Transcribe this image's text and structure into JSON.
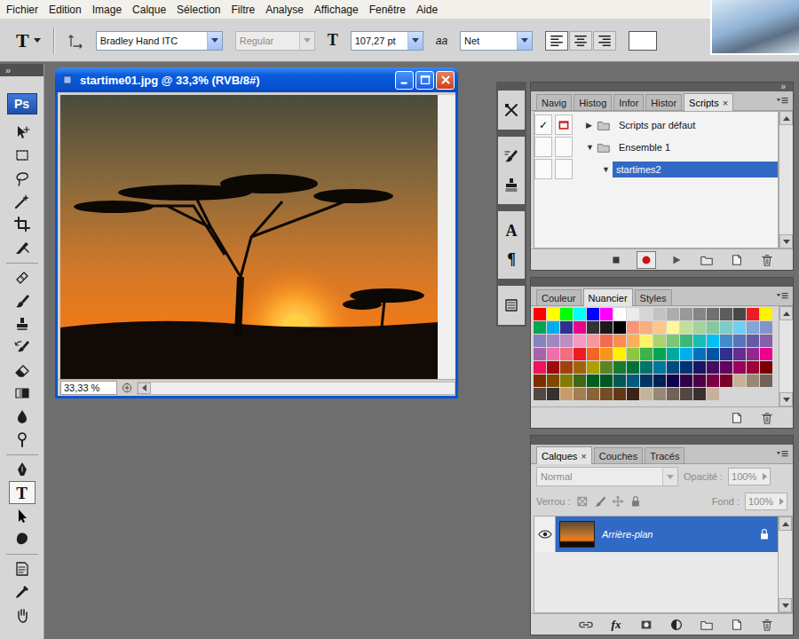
{
  "menu_bar": {
    "items": [
      "Fichier",
      "Edition",
      "Image",
      "Calque",
      "Sélection",
      "Filtre",
      "Analyse",
      "Affichage",
      "Fenêtre",
      "Aide"
    ]
  },
  "options_bar": {
    "tool_glyph": "T",
    "font_family": {
      "value": "Bradley Hand ITC",
      "disabled": false
    },
    "font_style": {
      "value": "Regular",
      "disabled": true
    },
    "size_glyph": "T",
    "font_size": {
      "value": "107,27 pt",
      "disabled": false
    },
    "antialias_glyph": "aa",
    "antialias": {
      "value": "Net",
      "disabled": false
    },
    "align": [
      {
        "kind": "align-left",
        "selected": true
      },
      {
        "kind": "align-center",
        "selected": false
      },
      {
        "kind": "align-right",
        "selected": false
      }
    ]
  },
  "toolbox": {
    "collapse": "»",
    "logo": "Ps",
    "tools": [
      {
        "kind": "move",
        "selected": false
      },
      {
        "kind": "marquee",
        "selected": false
      },
      {
        "kind": "lasso",
        "selected": false
      },
      {
        "kind": "wand",
        "selected": false
      },
      {
        "kind": "crop",
        "selected": false
      },
      {
        "kind": "slice",
        "selected": false
      },
      {
        "kind": "separator",
        "selected": false
      },
      {
        "kind": "healing",
        "selected": false
      },
      {
        "kind": "brush",
        "selected": false
      },
      {
        "kind": "stamp",
        "selected": false
      },
      {
        "kind": "history-brush",
        "selected": false
      },
      {
        "kind": "eraser",
        "selected": false
      },
      {
        "kind": "gradient",
        "selected": false
      },
      {
        "kind": "blur",
        "selected": false
      },
      {
        "kind": "dodge",
        "selected": false
      },
      {
        "kind": "separator",
        "selected": false
      },
      {
        "kind": "pen",
        "selected": false
      },
      {
        "kind": "glyph",
        "glyph": "T",
        "selected": true
      },
      {
        "kind": "path-select",
        "selected": false
      },
      {
        "kind": "shape",
        "selected": false
      },
      {
        "kind": "separator",
        "selected": false
      },
      {
        "kind": "notes",
        "selected": false
      },
      {
        "kind": "eyedropper",
        "selected": false
      },
      {
        "kind": "hand",
        "selected": false
      }
    ]
  },
  "document": {
    "title": "startime01.jpg @ 33,3% (RVB/8#)",
    "zoom": "33,33 %"
  },
  "icon_strip": [
    {
      "items": [
        {
          "kind": "tool-presets"
        }
      ]
    },
    {
      "items": [
        {
          "kind": "brushes"
        },
        {
          "kind": "clone-source"
        }
      ]
    },
    {
      "items": [
        {
          "kind": "glyph",
          "glyph": "A"
        },
        {
          "kind": "glyph",
          "glyph": "¶"
        }
      ]
    },
    {
      "items": [
        {
          "kind": "layer-comps"
        }
      ]
    }
  ],
  "dock_collapse": "»",
  "scripts_panel": {
    "tabs": [
      {
        "label": "Navig",
        "selected": false
      },
      {
        "label": "Histog",
        "selected": false
      },
      {
        "label": "Infor",
        "selected": false
      },
      {
        "label": "Histor",
        "selected": false
      },
      {
        "label": "Scripts",
        "selected": true,
        "close": "×"
      }
    ],
    "check_mark": "✓",
    "rows": [
      {
        "checked": true,
        "dialog": true,
        "depth": 0,
        "toggle": "▶",
        "folder": true,
        "label": "Scripts par défaut",
        "selected": false
      },
      {
        "checked": false,
        "dialog": false,
        "depth": 0,
        "toggle": "▼",
        "folder": true,
        "label": "Ensemble 1",
        "selected": false
      },
      {
        "checked": false,
        "dialog": false,
        "depth": 1,
        "toggle": "▼",
        "folder": false,
        "label": "startimes2",
        "selected": true
      }
    ],
    "buttons": [
      {
        "kind": "stop",
        "selected": false
      },
      {
        "kind": "record",
        "selected": true
      },
      {
        "kind": "play",
        "selected": false
      },
      {
        "kind": "new-set",
        "selected": false
      },
      {
        "kind": "new-action",
        "selected": false
      },
      {
        "kind": "delete",
        "selected": false
      }
    ]
  },
  "swatches_panel": {
    "tabs": [
      {
        "label": "Couleur",
        "selected": false
      },
      {
        "label": "Nuancier",
        "selected": true
      },
      {
        "label": "Styles",
        "selected": false
      }
    ],
    "swatches": [
      {
        "color": "#ff0000"
      },
      {
        "color": "#ffff00"
      },
      {
        "color": "#00ff00"
      },
      {
        "color": "#00ffff"
      },
      {
        "color": "#0000ff"
      },
      {
        "color": "#ff00ff"
      },
      {
        "color": "#ffffff"
      },
      {
        "color": "#ebebeb"
      },
      {
        "color": "#d6d6d6"
      },
      {
        "color": "#c2c2c2"
      },
      {
        "color": "#adadad"
      },
      {
        "color": "#999999"
      },
      {
        "color": "#858585"
      },
      {
        "color": "#707070"
      },
      {
        "color": "#5c5c5c"
      },
      {
        "color": "#474747"
      },
      {
        "color": "#ed1c24"
      },
      {
        "color": "#fff200"
      },
      {
        "color": "#00a651"
      },
      {
        "color": "#00aeef"
      },
      {
        "color": "#2e3192"
      },
      {
        "color": "#ec008c"
      },
      {
        "color": "#333333"
      },
      {
        "color": "#1a1a1a"
      },
      {
        "color": "#000000"
      },
      {
        "color": "#f7977a"
      },
      {
        "color": "#f9ad81"
      },
      {
        "color": "#fdc68a"
      },
      {
        "color": "#fff79a"
      },
      {
        "color": "#c4df9b"
      },
      {
        "color": "#a3d39c"
      },
      {
        "color": "#82ca9d"
      },
      {
        "color": "#7bcdc8"
      },
      {
        "color": "#6ecff6"
      },
      {
        "color": "#7ea7d8"
      },
      {
        "color": "#8493ca"
      },
      {
        "color": "#8882be"
      },
      {
        "color": "#a187be"
      },
      {
        "color": "#bc8dbf"
      },
      {
        "color": "#f49ac2"
      },
      {
        "color": "#f6989d"
      },
      {
        "color": "#f26c4f"
      },
      {
        "color": "#f68e55"
      },
      {
        "color": "#fbaf5c"
      },
      {
        "color": "#fff467"
      },
      {
        "color": "#acd372"
      },
      {
        "color": "#7cc576"
      },
      {
        "color": "#3bb878"
      },
      {
        "color": "#1abbb4"
      },
      {
        "color": "#00bff3"
      },
      {
        "color": "#438ccb"
      },
      {
        "color": "#5574b9"
      },
      {
        "color": "#605ca8"
      },
      {
        "color": "#855fa8"
      },
      {
        "color": "#a763a8"
      },
      {
        "color": "#f06ea9"
      },
      {
        "color": "#f26d7d"
      },
      {
        "color": "#ed1c24"
      },
      {
        "color": "#f26522"
      },
      {
        "color": "#f7941d"
      },
      {
        "color": "#fff200"
      },
      {
        "color": "#8dc73f"
      },
      {
        "color": "#39b54a"
      },
      {
        "color": "#00a651"
      },
      {
        "color": "#00a99d"
      },
      {
        "color": "#00aeef"
      },
      {
        "color": "#0072bc"
      },
      {
        "color": "#0054a6"
      },
      {
        "color": "#2e3192"
      },
      {
        "color": "#662d91"
      },
      {
        "color": "#92278f"
      },
      {
        "color": "#ec008c"
      },
      {
        "color": "#ed145b"
      },
      {
        "color": "#9e0b0f"
      },
      {
        "color": "#a0410d"
      },
      {
        "color": "#a36209"
      },
      {
        "color": "#aba000"
      },
      {
        "color": "#598527"
      },
      {
        "color": "#197b30"
      },
      {
        "color": "#007236"
      },
      {
        "color": "#00746b"
      },
      {
        "color": "#0076a3"
      },
      {
        "color": "#004b80"
      },
      {
        "color": "#003471"
      },
      {
        "color": "#1b1464"
      },
      {
        "color": "#440e62"
      },
      {
        "color": "#630460"
      },
      {
        "color": "#9e005d"
      },
      {
        "color": "#9e0039"
      },
      {
        "color": "#790000"
      },
      {
        "color": "#7b2e00"
      },
      {
        "color": "#7d4900"
      },
      {
        "color": "#827b00"
      },
      {
        "color": "#406618"
      },
      {
        "color": "#005e20"
      },
      {
        "color": "#005826"
      },
      {
        "color": "#005952"
      },
      {
        "color": "#005b7f"
      },
      {
        "color": "#003663"
      },
      {
        "color": "#002157"
      },
      {
        "color": "#0d004c"
      },
      {
        "color": "#32004b"
      },
      {
        "color": "#4b0049"
      },
      {
        "color": "#7b0046"
      },
      {
        "color": "#7a0026"
      },
      {
        "color": "#c7b299"
      },
      {
        "color": "#998675"
      },
      {
        "color": "#736357"
      },
      {
        "color": "#534741"
      },
      {
        "color": "#37302d"
      },
      {
        "color": "#c69c6d"
      },
      {
        "color": "#a67c52"
      },
      {
        "color": "#8c6239"
      },
      {
        "color": "#754c24"
      },
      {
        "color": "#603913"
      },
      {
        "color": "#3c2415"
      },
      {
        "color": "#c2b59b"
      },
      {
        "color": "#998675"
      },
      {
        "color": "#736357"
      },
      {
        "color": "#534741"
      },
      {
        "color": "#37302d"
      },
      {
        "color": "#c7b299"
      }
    ],
    "buttons": [
      {
        "kind": "new-swatch"
      },
      {
        "kind": "delete"
      }
    ]
  },
  "layers_panel": {
    "tabs": [
      {
        "label": "Calques",
        "selected": true,
        "close": "×"
      },
      {
        "label": "Couches",
        "selected": false
      },
      {
        "label": "Tracés",
        "selected": false
      }
    ],
    "blend_mode": {
      "value": "Normal",
      "disabled": true
    },
    "opacity": {
      "label": "Opacité :",
      "value": "100%",
      "disabled": true
    },
    "lock": {
      "label": "Verrou :",
      "disabled": true,
      "options": [
        {
          "kind": "lock-transparency"
        },
        {
          "kind": "lock-pixels"
        },
        {
          "kind": "lock-position"
        },
        {
          "kind": "lock-all"
        }
      ]
    },
    "fill": {
      "label": "Fond :",
      "value": "100%",
      "disabled": true
    },
    "layers": [
      {
        "name": "Arrière-plan",
        "visible": true,
        "locked": true,
        "selected": true
      }
    ],
    "buttons": [
      {
        "kind": "link"
      },
      {
        "kind": "glyph",
        "glyph": "fx"
      },
      {
        "kind": "mask"
      },
      {
        "kind": "adjustment"
      },
      {
        "kind": "group"
      },
      {
        "kind": "new-layer"
      },
      {
        "kind": "delete"
      }
    ]
  }
}
